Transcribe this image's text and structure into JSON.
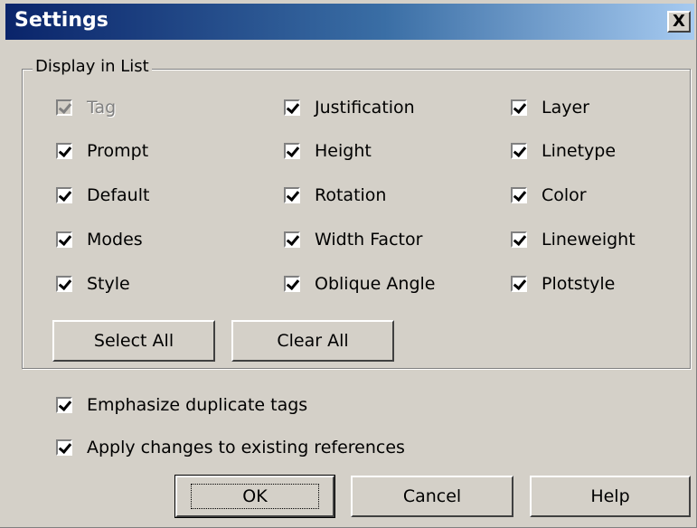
{
  "window": {
    "title": "Settings",
    "close_label": "X"
  },
  "display_group": {
    "label": "Display in List",
    "checkboxes": [
      {
        "label": "Tag",
        "checked": true,
        "enabled": false
      },
      {
        "label": "Prompt",
        "checked": true,
        "enabled": true
      },
      {
        "label": "Default",
        "checked": true,
        "enabled": true
      },
      {
        "label": "Modes",
        "checked": true,
        "enabled": true
      },
      {
        "label": "Style",
        "checked": true,
        "enabled": true
      },
      {
        "label": "Justification",
        "checked": true,
        "enabled": true
      },
      {
        "label": "Height",
        "checked": true,
        "enabled": true
      },
      {
        "label": "Rotation",
        "checked": true,
        "enabled": true
      },
      {
        "label": "Width Factor",
        "checked": true,
        "enabled": true
      },
      {
        "label": "Oblique Angle",
        "checked": true,
        "enabled": true
      },
      {
        "label": "Layer",
        "checked": true,
        "enabled": true
      },
      {
        "label": "Linetype",
        "checked": true,
        "enabled": true
      },
      {
        "label": "Color",
        "checked": true,
        "enabled": true
      },
      {
        "label": "Lineweight",
        "checked": true,
        "enabled": true
      },
      {
        "label": "Plotstyle",
        "checked": true,
        "enabled": true
      }
    ],
    "select_all_label": "Select All",
    "clear_all_label": "Clear All"
  },
  "options": {
    "emphasize_label": "Emphasize duplicate tags",
    "apply_label": "Apply changes to existing references"
  },
  "buttons": {
    "ok": "OK",
    "cancel": "Cancel",
    "help": "Help"
  }
}
